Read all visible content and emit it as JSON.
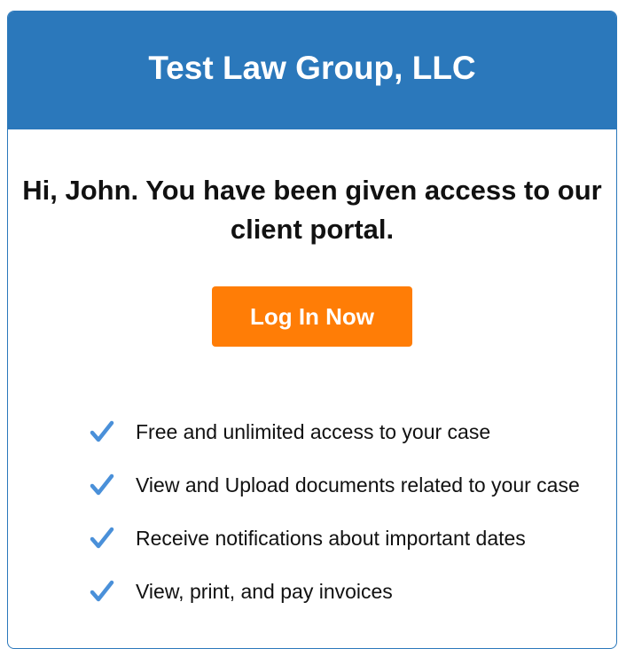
{
  "header": {
    "firm_name": "Test Law Group, LLC"
  },
  "message": {
    "greeting": "Hi, John. You have been given access to our client portal."
  },
  "cta": {
    "label": "Log In Now"
  },
  "features": [
    {
      "text": "Free and unlimited access to your case",
      "icon": "check-icon"
    },
    {
      "text": "View and Upload documents related to your case",
      "icon": "check-icon"
    },
    {
      "text": "Receive notifications about important dates",
      "icon": "check-icon"
    },
    {
      "text": "View, print, and pay invoices",
      "icon": "check-icon"
    }
  ],
  "colors": {
    "brand_blue": "#2b78bb",
    "cta_orange": "#ff7d06",
    "check_blue": "#4a90d9"
  }
}
